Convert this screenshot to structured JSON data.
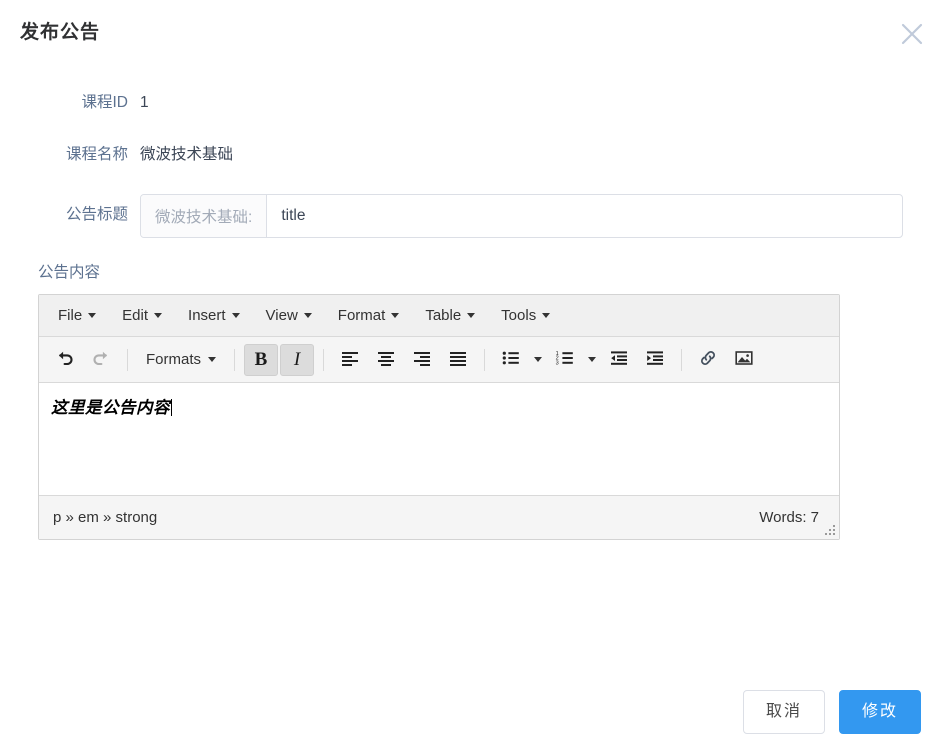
{
  "dialog": {
    "title": "发布公告",
    "close_icon": "close-icon"
  },
  "form": {
    "course_id": {
      "label": "课程ID",
      "value": "1"
    },
    "course_name": {
      "label": "课程名称",
      "value": "微波技术基础"
    },
    "announcement_title": {
      "label": "公告标题",
      "prepend": "微波技术基础:",
      "value": "title",
      "placeholder": "title"
    },
    "announcement_content": {
      "label": "公告内容"
    }
  },
  "editor": {
    "menubar": [
      {
        "label": "File"
      },
      {
        "label": "Edit"
      },
      {
        "label": "Insert"
      },
      {
        "label": "View"
      },
      {
        "label": "Format"
      },
      {
        "label": "Table"
      },
      {
        "label": "Tools"
      }
    ],
    "toolbar": {
      "undo": "undo-icon",
      "redo": "redo-icon",
      "formats_label": "Formats",
      "bold": "B",
      "italic": "I",
      "align_left": "align-left-icon",
      "align_center": "align-center-icon",
      "align_right": "align-right-icon",
      "align_justify": "align-justify-icon",
      "bullet_list": "bullet-list-icon",
      "numbered_list": "numbered-list-icon",
      "outdent": "outdent-icon",
      "indent": "indent-icon",
      "link": "link-icon",
      "image": "image-icon"
    },
    "content": "这里是公告内容",
    "statusbar": {
      "element_path": "p » em » strong",
      "word_count": "Words: 7"
    }
  },
  "footer": {
    "cancel_label": "取消",
    "confirm_label": "修改"
  },
  "colors": {
    "primary": "#3398f0",
    "label_text": "#5d7290",
    "border": "#dcdfe6",
    "editor_chrome": "#f0f0f0"
  }
}
